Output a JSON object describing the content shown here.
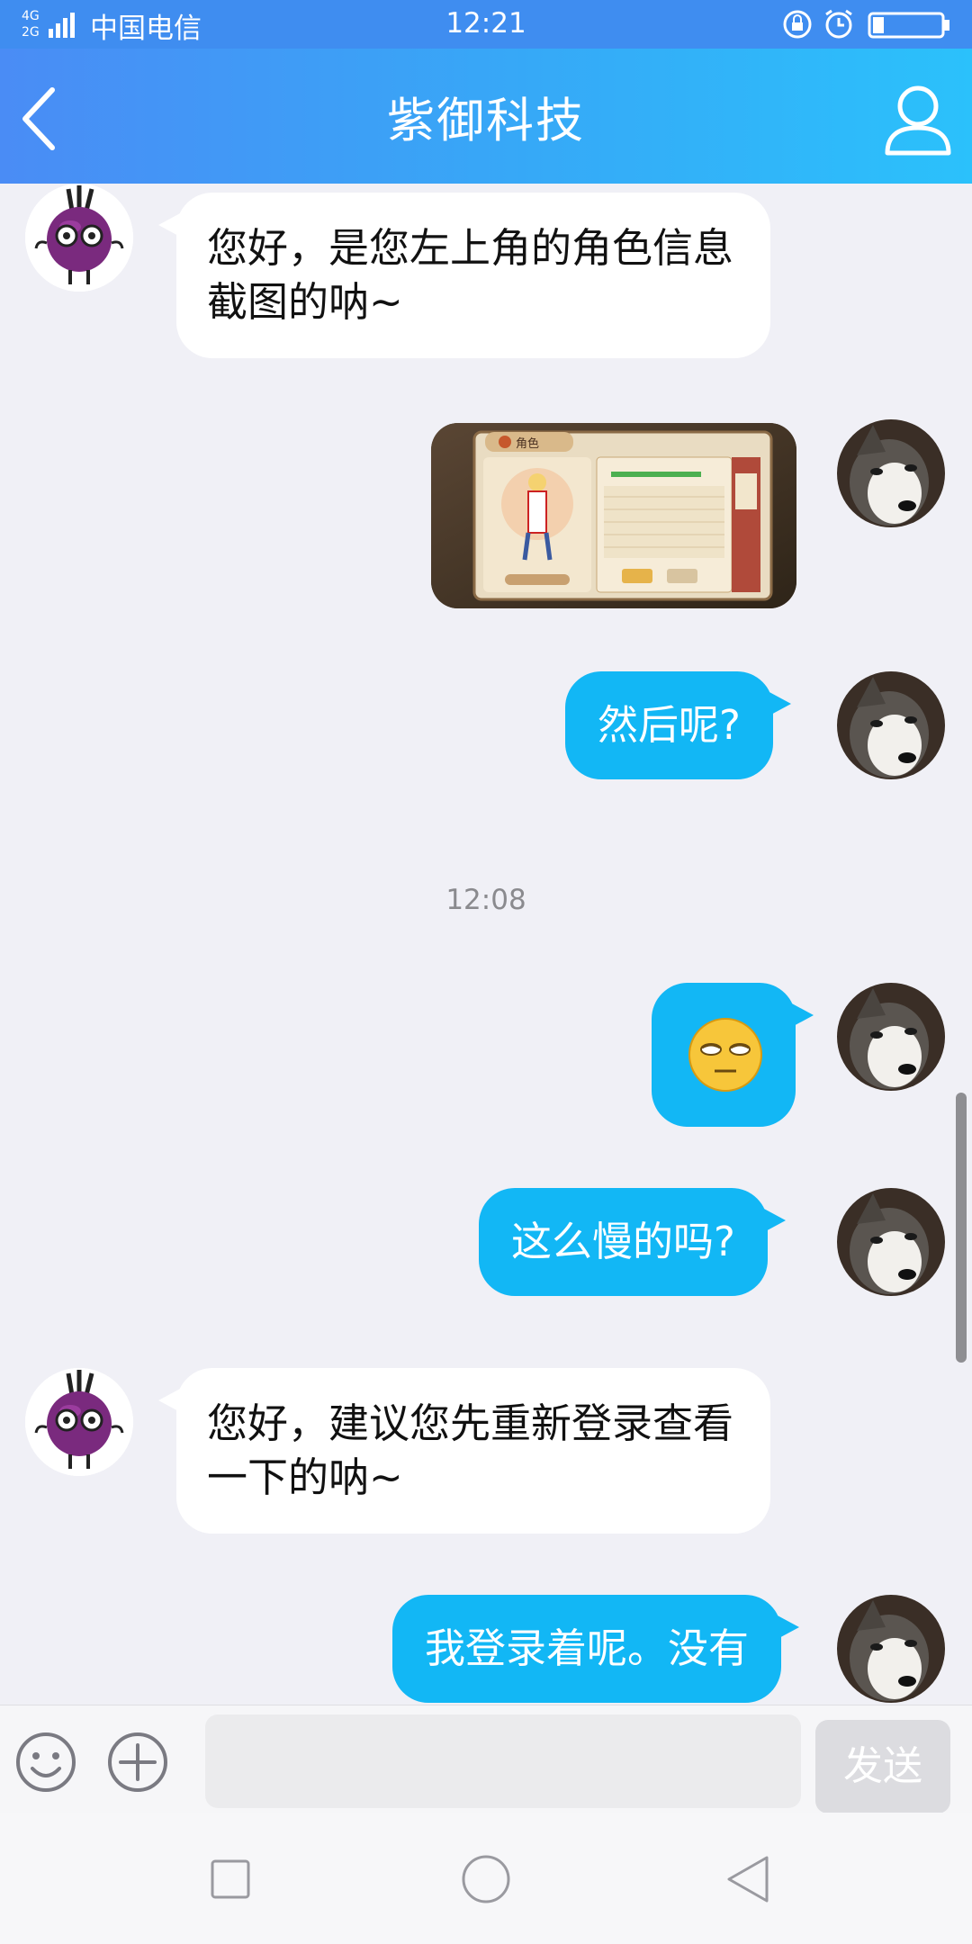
{
  "status_bar": {
    "network": "4G 2G",
    "carrier": "中国电信",
    "time": "12:21"
  },
  "header": {
    "title": "紫御科技"
  },
  "messages": [
    {
      "side": "in",
      "type": "text",
      "text": "您好，是您左上角的角色信息截图的呐~"
    },
    {
      "side": "out",
      "type": "image",
      "image": "game-character-screenshot",
      "tab_label": "角色"
    },
    {
      "side": "out",
      "type": "text",
      "text": "然后呢?"
    },
    {
      "type": "time",
      "text": "12:08"
    },
    {
      "side": "out",
      "type": "emoji",
      "emoji": "eye-roll-face"
    },
    {
      "side": "out",
      "type": "text",
      "text": "这么慢的吗?"
    },
    {
      "side": "in",
      "type": "text",
      "text": "您好，建议您先重新登录查看一下的呐~"
    },
    {
      "side": "out",
      "type": "text",
      "text": "我登录着呢。没有"
    }
  ],
  "input_bar": {
    "placeholder": "",
    "send_label": "发送"
  },
  "colors": {
    "header_start": "#4a8cf5",
    "header_end": "#2bc1fb",
    "outgoing_bubble": "#12b7f5",
    "incoming_bubble": "#ffffff",
    "background": "#f0f0f6"
  }
}
